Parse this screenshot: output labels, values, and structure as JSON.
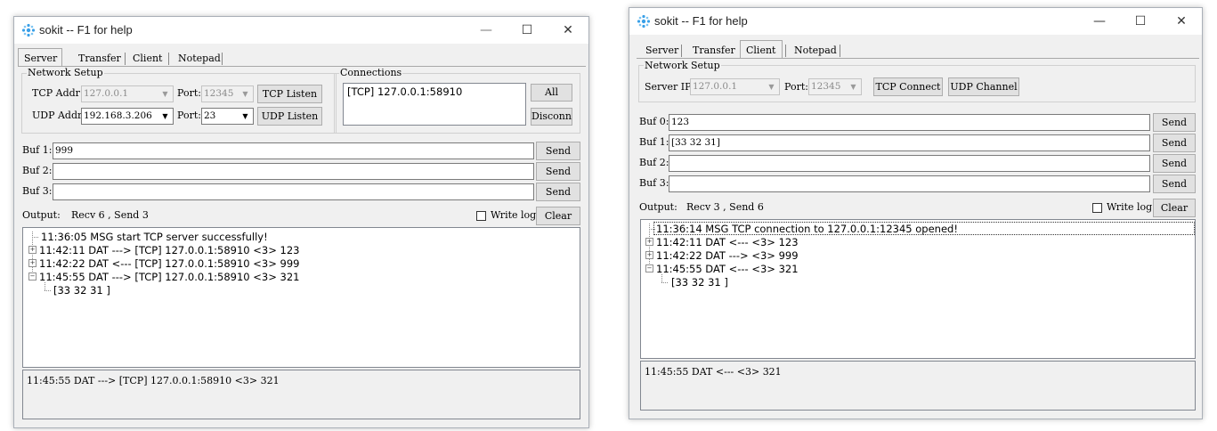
{
  "left_window": {
    "title": "sokit -- F1 for help",
    "caption": {
      "minimize": "—",
      "maximize": "☐",
      "close": "✕"
    },
    "tabs": [
      "Server",
      "Transfer",
      "Client",
      "Notepad"
    ],
    "active_tab": "Server",
    "network_setup": {
      "label": "Network Setup",
      "tcp_addr_label": "TCP Addr:",
      "tcp_addr_value": "127.0.0.1",
      "tcp_port_label": "Port:",
      "tcp_port_value": "12345",
      "tcp_listen_button": "TCP Listen",
      "udp_addr_label": "UDP Addr:",
      "udp_addr_value": "192.168.3.206",
      "udp_port_label": "Port:",
      "udp_port_value": "23",
      "udp_listen_button": "UDP Listen"
    },
    "connections": {
      "label": "Connections",
      "items": [
        "[TCP] 127.0.0.1:58910"
      ],
      "all_button": "All",
      "disconn_button": "Disconn"
    },
    "buffers": [
      {
        "label": "Buf 1:",
        "value": "999",
        "send": "Send"
      },
      {
        "label": "Buf 2:",
        "value": "",
        "send": "Send"
      },
      {
        "label": "Buf 3:",
        "value": "",
        "send": "Send"
      }
    ],
    "output_label": "Output:",
    "output_stats": "Recv 6 , Send 3",
    "write_log_label": "Write log",
    "clear_button": "Clear",
    "log": [
      "11:36:05 MSG start TCP server successfully!",
      "11:42:11 DAT ---> [TCP] 127.0.0.1:58910 <3> 123",
      "11:42:22 DAT <--- [TCP] 127.0.0.1:58910 <3> 999",
      "11:45:55 DAT ---> [TCP] 127.0.0.1:58910 <3> 321",
      "[33 32 31 ]"
    ],
    "status": "11:45:55 DAT ---> [TCP] 127.0.0.1:58910 <3> 321"
  },
  "right_window": {
    "title": "sokit -- F1 for help",
    "caption": {
      "minimize": "—",
      "maximize": "☐",
      "close": "✕"
    },
    "tabs": [
      "Server",
      "Transfer",
      "Client",
      "Notepad"
    ],
    "active_tab": "Client",
    "network_setup": {
      "label": "Network Setup",
      "server_ip_label": "Server IP:",
      "server_ip_value": "127.0.0.1",
      "port_label": "Port:",
      "port_value": "12345",
      "tcp_connect_button": "TCP Connect",
      "udp_channel_button": "UDP Channel"
    },
    "buffers": [
      {
        "label": "Buf 0:",
        "value": "123",
        "send": "Send"
      },
      {
        "label": "Buf 1:",
        "value": "[33 32 31]",
        "send": "Send"
      },
      {
        "label": "Buf 2:",
        "value": "",
        "send": "Send"
      },
      {
        "label": "Buf 3:",
        "value": "",
        "send": "Send"
      }
    ],
    "output_label": "Output:",
    "output_stats": "Recv 3 , Send 6",
    "write_log_label": "Write log",
    "clear_button": "Clear",
    "log": [
      "11:36:14 MSG TCP connection to 127.0.0.1:12345 opened!",
      "11:42:11 DAT <--- <3> 123",
      "11:42:22 DAT ---> <3> 999",
      "11:45:55 DAT <--- <3> 321",
      "[33 32 31 ]"
    ],
    "status": "11:45:55 DAT <--- <3> 321"
  },
  "colors": {
    "icon_accent": "#3aa0e8",
    "window_bg": "#f0f0f0",
    "default_button_border": "#0078d7"
  }
}
